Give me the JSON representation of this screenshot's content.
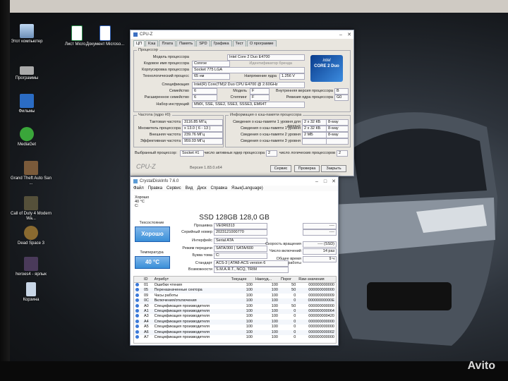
{
  "desktop": {
    "icons": [
      {
        "label": "Этот компьютер",
        "icon": "computer-icon"
      },
      {
        "label": "Программы",
        "icon": "drive-icon"
      },
      {
        "label": "Фильмы",
        "icon": "film-folder-icon"
      },
      {
        "label": "MediaGet",
        "icon": "mediaget-icon"
      },
      {
        "label": "Grand Theft Auto San ...",
        "icon": "gta-icon"
      },
      {
        "label": "Call of Duty 4 Modern Wa...",
        "icon": "cod-icon"
      },
      {
        "label": "Dead Space 3",
        "icon": "deadspace-icon"
      },
      {
        "label": "heroes4 - ярлык",
        "icon": "heroes-icon"
      },
      {
        "label": "Корзина",
        "icon": "recycle-bin-icon"
      },
      {
        "label": "Лист Micro...",
        "icon": "excel-icon"
      },
      {
        "label": "Документ Microso...",
        "icon": "word-icon"
      }
    ]
  },
  "cpuz": {
    "title": "CPU-Z",
    "tabs": [
      "ЦП",
      "Кэш",
      "Плата",
      "Память",
      "SPD",
      "Графика",
      "Тест",
      "О программе"
    ],
    "processor_legend": "Процессор",
    "fields": [
      {
        "label": "Модель процессора",
        "value": "Intel Core 2 Duo E4700"
      },
      {
        "label": "Кодовое имя процессора",
        "value": "Conroe"
      },
      {
        "label": "Корпусировка процессора",
        "value": "Socket 775 LGA"
      },
      {
        "label": "Технологический процесс",
        "value": "65 нм"
      },
      {
        "label": "Спецификация",
        "value": "Intel(R) Core(TM)2 Duo CPU    E4700 @ 2.60GHz"
      },
      {
        "label": "Семейство",
        "value": "6"
      },
      {
        "label": "Расширенное семейство",
        "value": "6"
      },
      {
        "label": "Набор инструкций",
        "value": "MMX, SSE, SSE2, SSE3, SSSE3, EM64T"
      }
    ],
    "brand_id_label": "Идентификатор бренда",
    "voltage_label": "Напряжение ядра",
    "voltage": "1.256 V",
    "model_label": "Модель",
    "model_value": "F",
    "stepping_label": "Степпинг",
    "stepping_value": "F",
    "inner_rev_label": "Внутренняя версия процессора",
    "inner_rev_value": "B",
    "rev_label": "Ревизия ядра процессора",
    "rev_value": "G0",
    "clocks_legend": "Частота (ядро #0)",
    "clocks": [
      {
        "label": "Тактовая частота",
        "value": "3116.85 МГц"
      },
      {
        "label": "Множитель процессора",
        "value": "x 13.0 ( 6 - 13 )"
      },
      {
        "label": "Внешняя частота",
        "value": "239.76 МГц"
      },
      {
        "label": "Эффективная частота",
        "value": "959.03 МГц"
      }
    ],
    "cache_legend": "Информация о кэш-памяти процессора",
    "cache": [
      {
        "label": "Сведения о кэш-памяти 1 уровня для данных",
        "size": "2 x 32 КБ",
        "ways": "8-way"
      },
      {
        "label": "Сведения о кэш-памяти 1 уровня",
        "size": "2 x 32 КБ",
        "ways": "8-way"
      },
      {
        "label": "Сведения о кэш-памяти 2 уровня",
        "size": "2 МБ",
        "ways": "8-way"
      },
      {
        "label": "Сведения о кэш-памяти 3 уровня",
        "size": "",
        "ways": ""
      }
    ],
    "selected_cpu_label": "Выбранный процессор:",
    "selected_cpu": "Socket #1",
    "active_cores_label": "число активных ядер процессора",
    "active_cores": "2",
    "logical_label": "число логических процессоров",
    "logical": "2",
    "footer_brand": "CPU-Z",
    "version": "Версия 1.83.0.x64",
    "service_btn": "Сервис",
    "check_btn": "Проверка",
    "close_btn": "Закрыть",
    "logo_text": "CORE 2 Duo",
    "logo_brand": "intel"
  },
  "crystal": {
    "title": "CrystalDiskInfo 7.6.0",
    "menu": [
      "Файл",
      "Правка",
      "Сервис",
      "Вид",
      "Диск",
      "Справка",
      "Язык(Language)"
    ],
    "drive_status": "Хорошо",
    "drive_temp": "40 °C",
    "drive_letter": "C:",
    "disk_title": "SSD 128GB 128,0 GB",
    "tech_label": "Техсостояние",
    "tech_value": "Хорошо",
    "temp_label": "Температура",
    "temp_value": "40 °C",
    "fields": [
      {
        "label": "Прошивка",
        "value": "VE0R6313"
      },
      {
        "label": "Серийный номер",
        "value": "2023121000770"
      },
      {
        "label": "Интерфейс",
        "value": "Serial ATA"
      },
      {
        "label": "Режим передачи",
        "value": "SATA/300 | SATA/600"
      },
      {
        "label": "Буква тома",
        "value": "C:"
      },
      {
        "label": "Стандарт",
        "value": "ACS-3 | ATA8-ACS version 6"
      },
      {
        "label": "Возможности",
        "value": "S.M.A.R.T., NCQ, TRIM"
      }
    ],
    "right_fields": [
      {
        "label": "",
        "value": "----"
      },
      {
        "label": "",
        "value": "----"
      },
      {
        "label": "Скорость вращения",
        "value": "---- (SSD)"
      },
      {
        "label": "Число включений",
        "value": "14 раз"
      },
      {
        "label": "Общее время работы",
        "value": "9 ч"
      }
    ],
    "table_headers": [
      "ID",
      "Атрибут",
      "Текущее",
      "Наихуд...",
      "Порог",
      "Raw-значения"
    ],
    "rows": [
      {
        "id": "01",
        "name": "Ошибки чтения",
        "cur": "100",
        "worst": "100",
        "thr": "50",
        "raw": "000000000000"
      },
      {
        "id": "05",
        "name": "Переназначенные сектора",
        "cur": "100",
        "worst": "100",
        "thr": "50",
        "raw": "000000000000"
      },
      {
        "id": "09",
        "name": "Часы работы",
        "cur": "100",
        "worst": "100",
        "thr": "0",
        "raw": "000000000009"
      },
      {
        "id": "0C",
        "name": "Включения/отключения",
        "cur": "100",
        "worst": "100",
        "thr": "0",
        "raw": "00000000000E"
      },
      {
        "id": "A0",
        "name": "Спецификация производителя",
        "cur": "100",
        "worst": "100",
        "thr": "50",
        "raw": "000000000000"
      },
      {
        "id": "A1",
        "name": "Спецификация производителя",
        "cur": "100",
        "worst": "100",
        "thr": "0",
        "raw": "000000000064"
      },
      {
        "id": "A3",
        "name": "Спецификация производителя",
        "cur": "100",
        "worst": "100",
        "thr": "0",
        "raw": "000000000420"
      },
      {
        "id": "A4",
        "name": "Спецификация производителя",
        "cur": "100",
        "worst": "100",
        "thr": "0",
        "raw": "000000000000"
      },
      {
        "id": "A5",
        "name": "Спецификация производителя",
        "cur": "100",
        "worst": "100",
        "thr": "0",
        "raw": "000000000000"
      },
      {
        "id": "A6",
        "name": "Спецификация производителя",
        "cur": "100",
        "worst": "100",
        "thr": "0",
        "raw": "000000000002"
      },
      {
        "id": "A7",
        "name": "Спецификация производителя",
        "cur": "100",
        "worst": "100",
        "thr": "0",
        "raw": "000000000000"
      }
    ]
  },
  "watermark": "Avito",
  "colors": {
    "good": "#3a8fd8",
    "accent": "#1e5fb0"
  }
}
